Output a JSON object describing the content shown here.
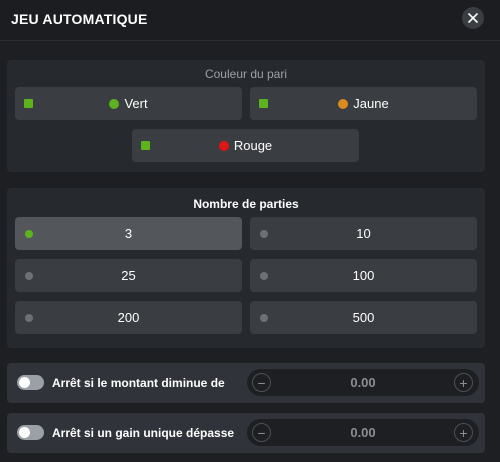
{
  "header": {
    "title": "JEU AUTOMATIQUE"
  },
  "bet_color": {
    "label": "Couleur du pari",
    "options": [
      {
        "label": "Vert",
        "color": "#5db31d"
      },
      {
        "label": "Jaune",
        "color": "#d98b1c"
      },
      {
        "label": "Rouge",
        "color": "#e01616"
      }
    ]
  },
  "rounds": {
    "label": "Nombre de parties",
    "options": [
      "3",
      "10",
      "25",
      "100",
      "200",
      "500"
    ],
    "selected": "3"
  },
  "stop_conditions": [
    {
      "label": "Arrêt si le montant diminue de",
      "value": "0.00"
    },
    {
      "label": "Arrêt si un gain unique dépasse",
      "value": "0.00"
    }
  ],
  "stepper": {
    "minus": "−",
    "plus": "+"
  },
  "colors": {
    "accent": "#5db31d",
    "background": "#1d1f23",
    "panel": "#26292d",
    "button": "#3a3d41"
  }
}
